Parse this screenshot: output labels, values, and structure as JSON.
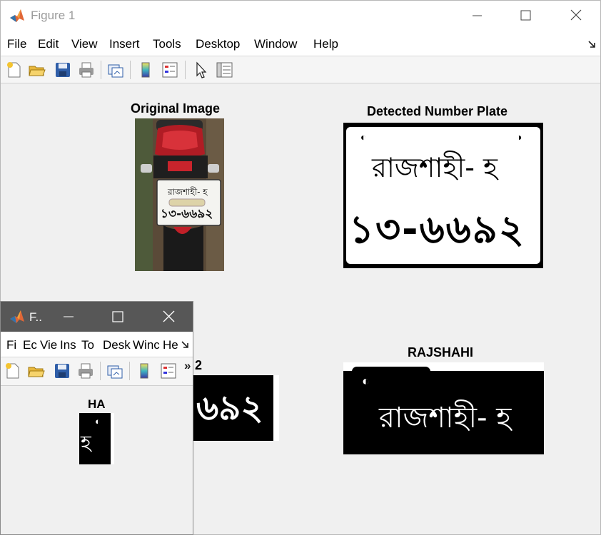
{
  "main_window": {
    "title": "Figure 1",
    "menu": [
      "File",
      "Edit",
      "View",
      "Insert",
      "Tools",
      "Desktop",
      "Window",
      "Help"
    ],
    "toolbar_icons": [
      "new-figure-icon",
      "open-file-icon",
      "save-icon",
      "print-icon",
      "link-plot-icon",
      "insert-colorbar-icon",
      "insert-legend-icon",
      "edit-plot-icon",
      "property-inspector-icon"
    ]
  },
  "axes": {
    "original": {
      "title": "Original Image",
      "plate_line1": "রাজশাহী- হ",
      "plate_line2": "১৩-৬৬৯২"
    },
    "detected": {
      "title": "Detected Number Plate",
      "line1": "রাজশাহী- হ",
      "line2": "১৩-৬৬৯২"
    },
    "number": {
      "title_fragment": "2",
      "text": "৬৯২"
    },
    "city": {
      "title": "RAJSHAHI",
      "text": "রাজশাহী- হ"
    }
  },
  "sub_window": {
    "title": "F..",
    "menu": [
      "Fi",
      "Ec",
      "Vie",
      "Ins",
      "To",
      "Desk",
      "Winc",
      "He"
    ],
    "overflow_label": "»",
    "toolbar_icons": [
      "new-figure-icon",
      "open-file-icon",
      "save-icon",
      "print-icon",
      "link-plot-icon",
      "insert-colorbar-icon",
      "insert-legend-icon"
    ],
    "axes": {
      "title": "HA",
      "glyph": "হ"
    }
  },
  "colors": {
    "window_bg": "#f0f0f0",
    "sub_title_bg": "#575757",
    "plate_black": "#000000"
  }
}
